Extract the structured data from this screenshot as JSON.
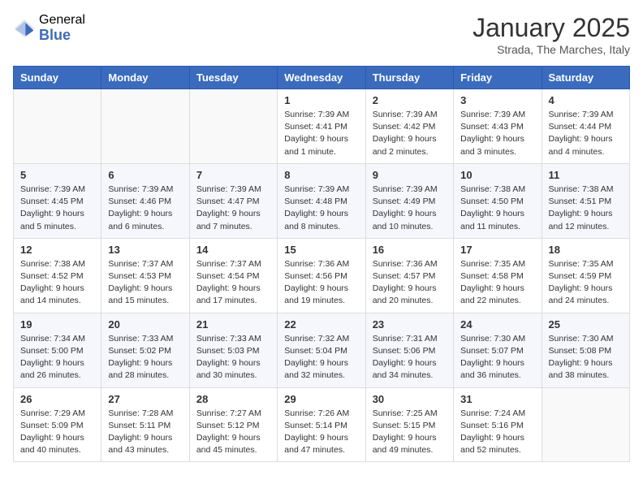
{
  "header": {
    "logo_general": "General",
    "logo_blue": "Blue",
    "month_title": "January 2025",
    "subtitle": "Strada, The Marches, Italy"
  },
  "days_of_week": [
    "Sunday",
    "Monday",
    "Tuesday",
    "Wednesday",
    "Thursday",
    "Friday",
    "Saturday"
  ],
  "weeks": [
    [
      {
        "day": "",
        "info": ""
      },
      {
        "day": "",
        "info": ""
      },
      {
        "day": "",
        "info": ""
      },
      {
        "day": "1",
        "info": "Sunrise: 7:39 AM\nSunset: 4:41 PM\nDaylight: 9 hours\nand 1 minute."
      },
      {
        "day": "2",
        "info": "Sunrise: 7:39 AM\nSunset: 4:42 PM\nDaylight: 9 hours\nand 2 minutes."
      },
      {
        "day": "3",
        "info": "Sunrise: 7:39 AM\nSunset: 4:43 PM\nDaylight: 9 hours\nand 3 minutes."
      },
      {
        "day": "4",
        "info": "Sunrise: 7:39 AM\nSunset: 4:44 PM\nDaylight: 9 hours\nand 4 minutes."
      }
    ],
    [
      {
        "day": "5",
        "info": "Sunrise: 7:39 AM\nSunset: 4:45 PM\nDaylight: 9 hours\nand 5 minutes."
      },
      {
        "day": "6",
        "info": "Sunrise: 7:39 AM\nSunset: 4:46 PM\nDaylight: 9 hours\nand 6 minutes."
      },
      {
        "day": "7",
        "info": "Sunrise: 7:39 AM\nSunset: 4:47 PM\nDaylight: 9 hours\nand 7 minutes."
      },
      {
        "day": "8",
        "info": "Sunrise: 7:39 AM\nSunset: 4:48 PM\nDaylight: 9 hours\nand 8 minutes."
      },
      {
        "day": "9",
        "info": "Sunrise: 7:39 AM\nSunset: 4:49 PM\nDaylight: 9 hours\nand 10 minutes."
      },
      {
        "day": "10",
        "info": "Sunrise: 7:38 AM\nSunset: 4:50 PM\nDaylight: 9 hours\nand 11 minutes."
      },
      {
        "day": "11",
        "info": "Sunrise: 7:38 AM\nSunset: 4:51 PM\nDaylight: 9 hours\nand 12 minutes."
      }
    ],
    [
      {
        "day": "12",
        "info": "Sunrise: 7:38 AM\nSunset: 4:52 PM\nDaylight: 9 hours\nand 14 minutes."
      },
      {
        "day": "13",
        "info": "Sunrise: 7:37 AM\nSunset: 4:53 PM\nDaylight: 9 hours\nand 15 minutes."
      },
      {
        "day": "14",
        "info": "Sunrise: 7:37 AM\nSunset: 4:54 PM\nDaylight: 9 hours\nand 17 minutes."
      },
      {
        "day": "15",
        "info": "Sunrise: 7:36 AM\nSunset: 4:56 PM\nDaylight: 9 hours\nand 19 minutes."
      },
      {
        "day": "16",
        "info": "Sunrise: 7:36 AM\nSunset: 4:57 PM\nDaylight: 9 hours\nand 20 minutes."
      },
      {
        "day": "17",
        "info": "Sunrise: 7:35 AM\nSunset: 4:58 PM\nDaylight: 9 hours\nand 22 minutes."
      },
      {
        "day": "18",
        "info": "Sunrise: 7:35 AM\nSunset: 4:59 PM\nDaylight: 9 hours\nand 24 minutes."
      }
    ],
    [
      {
        "day": "19",
        "info": "Sunrise: 7:34 AM\nSunset: 5:00 PM\nDaylight: 9 hours\nand 26 minutes."
      },
      {
        "day": "20",
        "info": "Sunrise: 7:33 AM\nSunset: 5:02 PM\nDaylight: 9 hours\nand 28 minutes."
      },
      {
        "day": "21",
        "info": "Sunrise: 7:33 AM\nSunset: 5:03 PM\nDaylight: 9 hours\nand 30 minutes."
      },
      {
        "day": "22",
        "info": "Sunrise: 7:32 AM\nSunset: 5:04 PM\nDaylight: 9 hours\nand 32 minutes."
      },
      {
        "day": "23",
        "info": "Sunrise: 7:31 AM\nSunset: 5:06 PM\nDaylight: 9 hours\nand 34 minutes."
      },
      {
        "day": "24",
        "info": "Sunrise: 7:30 AM\nSunset: 5:07 PM\nDaylight: 9 hours\nand 36 minutes."
      },
      {
        "day": "25",
        "info": "Sunrise: 7:30 AM\nSunset: 5:08 PM\nDaylight: 9 hours\nand 38 minutes."
      }
    ],
    [
      {
        "day": "26",
        "info": "Sunrise: 7:29 AM\nSunset: 5:09 PM\nDaylight: 9 hours\nand 40 minutes."
      },
      {
        "day": "27",
        "info": "Sunrise: 7:28 AM\nSunset: 5:11 PM\nDaylight: 9 hours\nand 43 minutes."
      },
      {
        "day": "28",
        "info": "Sunrise: 7:27 AM\nSunset: 5:12 PM\nDaylight: 9 hours\nand 45 minutes."
      },
      {
        "day": "29",
        "info": "Sunrise: 7:26 AM\nSunset: 5:14 PM\nDaylight: 9 hours\nand 47 minutes."
      },
      {
        "day": "30",
        "info": "Sunrise: 7:25 AM\nSunset: 5:15 PM\nDaylight: 9 hours\nand 49 minutes."
      },
      {
        "day": "31",
        "info": "Sunrise: 7:24 AM\nSunset: 5:16 PM\nDaylight: 9 hours\nand 52 minutes."
      },
      {
        "day": "",
        "info": ""
      }
    ]
  ]
}
